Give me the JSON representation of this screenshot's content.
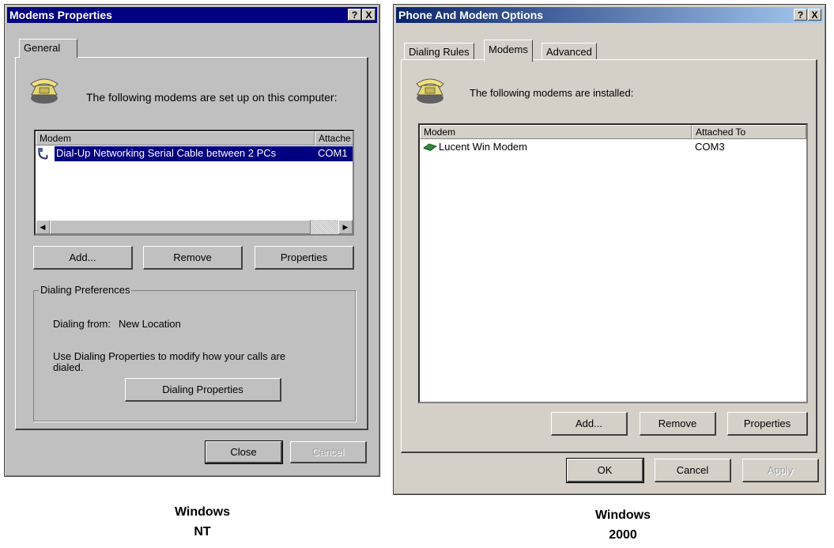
{
  "nt": {
    "title": "Modems Properties",
    "help_btn": "?",
    "close_btn": "X",
    "tab_general": "General",
    "intro": "The following modems are set up on this computer:",
    "col_modem": "Modem",
    "col_attached": "Attache",
    "rows": [
      {
        "modem": "Dial-Up Networking Serial Cable between 2 PCs",
        "attached": "COM1"
      }
    ],
    "add": "Add...",
    "remove": "Remove",
    "properties": "Properties",
    "group_label": "Dialing Preferences",
    "dialing_from_label": "Dialing from:",
    "dialing_from_value": "New Location",
    "dialing_note": "Use Dialing Properties to modify how your calls are dialed.",
    "dialing_properties": "Dialing Properties",
    "close": "Close",
    "cancel": "Cancel",
    "caption_line1": "Windows",
    "caption_line2": "NT"
  },
  "w2k": {
    "title": "Phone And Modem Options",
    "help_btn": "?",
    "close_btn": "X",
    "tabs": [
      "Dialing Rules",
      "Modems",
      "Advanced"
    ],
    "intro": "The following modems are installed:",
    "col_modem": "Modem",
    "col_attached": "Attached To",
    "rows": [
      {
        "modem": "Lucent Win Modem",
        "attached": "COM3"
      }
    ],
    "add": "Add...",
    "remove": "Remove",
    "properties": "Properties",
    "ok": "OK",
    "cancel": "Cancel",
    "apply": "Apply",
    "caption_line1": "Windows",
    "caption_line2": "2000"
  }
}
